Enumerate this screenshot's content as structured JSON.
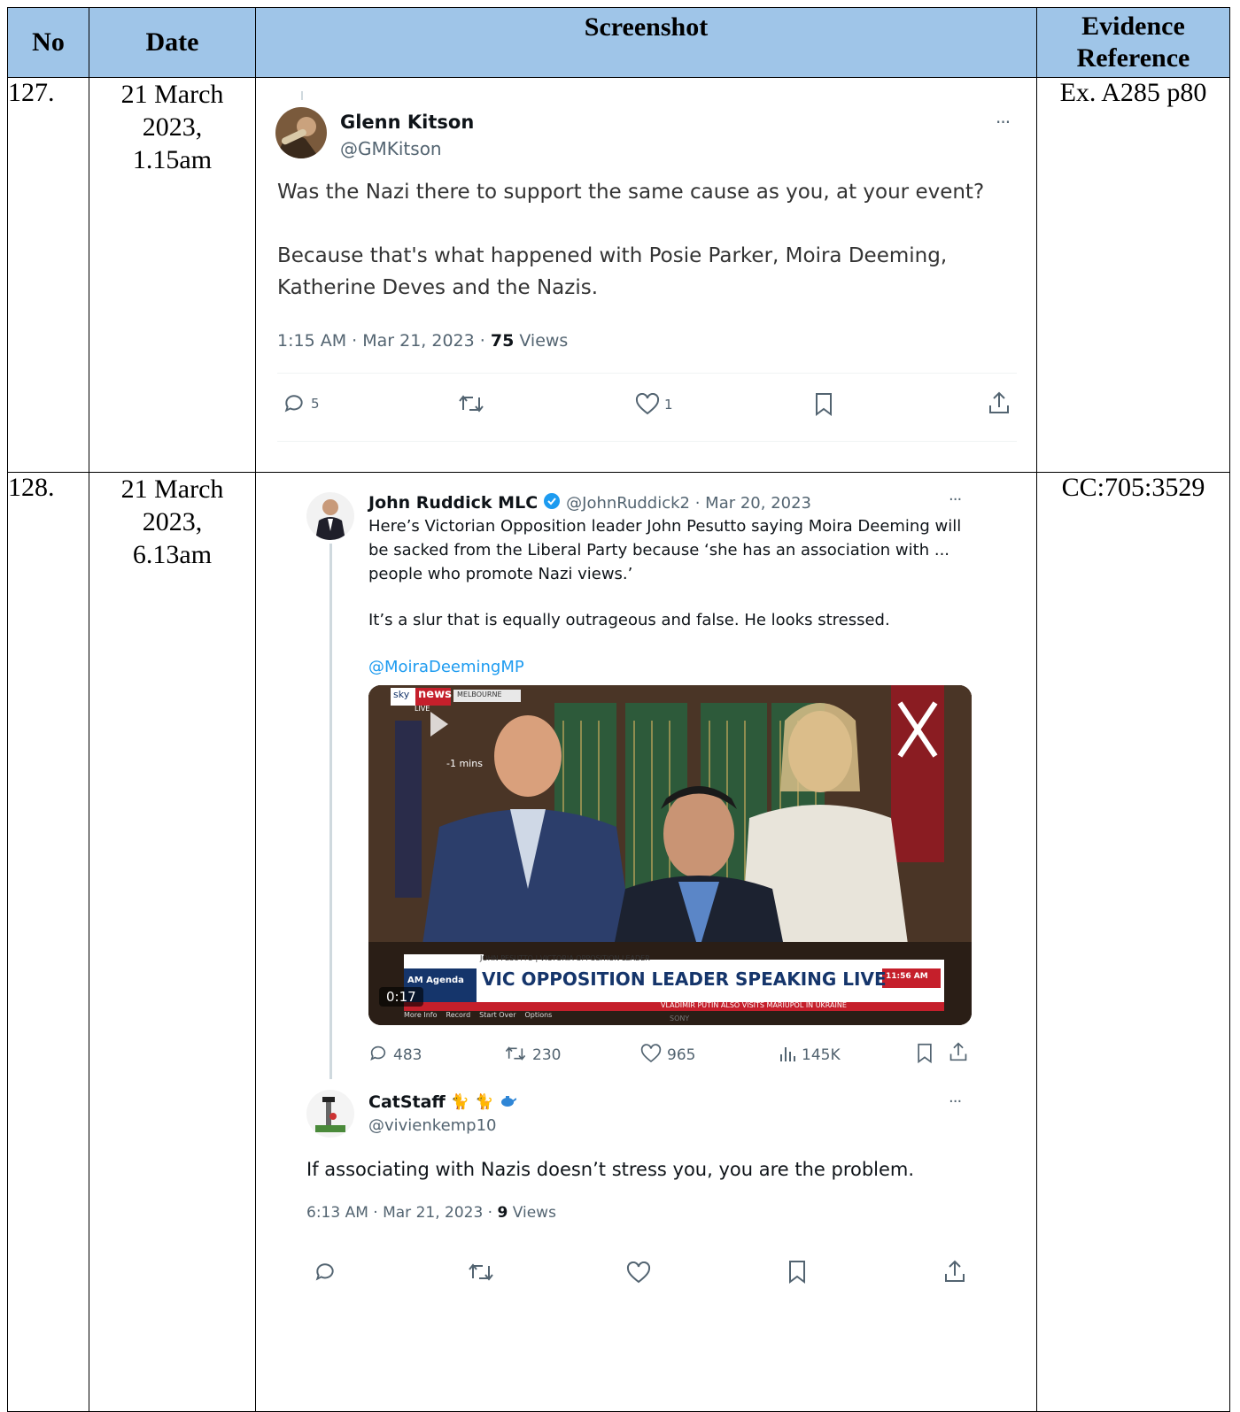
{
  "table": {
    "headers": {
      "no": "No",
      "date": "Date",
      "screenshot": "Screenshot",
      "evidence": "Evidence Reference"
    },
    "rows": [
      {
        "no": "127.",
        "date": [
          "21 March",
          "2023,",
          "1.15am"
        ],
        "evidence": "Ex. A285 p80",
        "tweet": {
          "name": "Glenn Kitson",
          "handle": "@GMKitson",
          "more": "···",
          "text1": "Was the Nazi there to support the same cause as you, at your event?",
          "text2a": "Because that's what happened with Posie Parker, Moira Deeming,",
          "text2b": "Katherine Deves and the Nazis.",
          "meta_time": "1:15 AM · Mar 21, 2023 · ",
          "meta_views_count": "75",
          "meta_views_label": " Views",
          "replies": "5",
          "likes": "1"
        }
      },
      {
        "no": "128.",
        "date": [
          "21 March",
          "2023,",
          "6.13am"
        ],
        "evidence": "CC:705:3529",
        "quoted": {
          "name": "John Ruddick MLC",
          "handle_date": "@JohnRuddick2 · Mar 20, 2023",
          "more": "···",
          "line1": "Here’s Victorian Opposition leader John Pesutto saying Moira Deeming will",
          "line2": "be sacked from the Liberal Party because ‘she has an association with ...",
          "line3": "people who promote Nazi views.’",
          "line4": "It’s a slur that is equally outrageous and false. He looks stressed.",
          "mention": "@MoiraDeemingMP",
          "video": {
            "brand_sky": "sky",
            "brand_news": "news",
            "brand_live": "LIVE",
            "location": "MELBOURNE",
            "mins": "-1 mins",
            "program": "AM Agenda",
            "lower_small": "JOHN PESUTTO | VICTORIA OPPOSITION LEADER",
            "headline": "VIC OPPOSITION LEADER SPEAKING LIVE",
            "clock": "11:56 AM",
            "ticker": "VLADIMIR PUTIN ALSO VISITS MARIUPOL IN UKRAINE",
            "duration": "0:17",
            "bar_more": "More Info",
            "bar_record": "Record",
            "bar_start": "Start Over",
            "bar_options": "Options",
            "tv_brand": "SONY"
          },
          "replies": "483",
          "retweets": "230",
          "likes": "965",
          "views": "145K"
        },
        "reply": {
          "name": "CatStaff",
          "handle": "@vivienkemp10",
          "more": "···",
          "text": "If associating with Nazis doesn’t stress you, you are the problem.",
          "meta_time": "6:13 AM · Mar 21, 2023 · ",
          "meta_views_count": "9",
          "meta_views_label": " Views"
        }
      }
    ]
  }
}
